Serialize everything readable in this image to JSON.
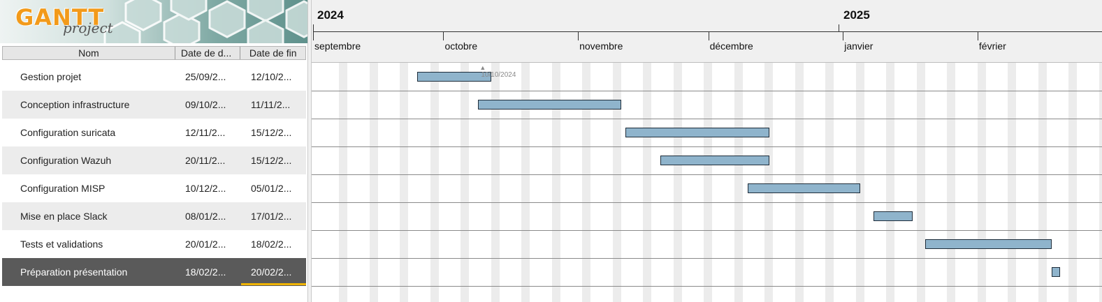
{
  "logo": {
    "main": "GANTT",
    "sub": "project"
  },
  "columns": {
    "name": "Nom",
    "start": "Date de d...",
    "end": "Date de fin"
  },
  "tasks": [
    {
      "name": "Gestion projet",
      "start": "25/09/2...",
      "end": "12/10/2...",
      "start_date": "2024-09-25",
      "end_date": "2024-10-12"
    },
    {
      "name": "Conception infrastructure",
      "start": "09/10/2...",
      "end": "11/11/2...",
      "start_date": "2024-10-09",
      "end_date": "2024-11-11"
    },
    {
      "name": "Configuration suricata",
      "start": "12/11/2...",
      "end": "15/12/2...",
      "start_date": "2024-11-12",
      "end_date": "2024-12-15"
    },
    {
      "name": "Configuration Wazuh",
      "start": "20/11/2...",
      "end": "15/12/2...",
      "start_date": "2024-11-20",
      "end_date": "2024-12-15"
    },
    {
      "name": "Configuration MISP",
      "start": "10/12/2...",
      "end": "05/01/2...",
      "start_date": "2024-12-10",
      "end_date": "2025-01-05"
    },
    {
      "name": "Mise en place Slack",
      "start": "08/01/2...",
      "end": "17/01/2...",
      "start_date": "2025-01-08",
      "end_date": "2025-01-17"
    },
    {
      "name": "Tests et validations",
      "start": "20/01/2...",
      "end": "18/02/2...",
      "start_date": "2025-01-20",
      "end_date": "2025-02-18"
    },
    {
      "name": "Préparation présentation",
      "start": "18/02/2...",
      "end": "20/02/2...",
      "start_date": "2025-02-18",
      "end_date": "2025-02-20"
    }
  ],
  "selected_index": 7,
  "timeline": {
    "years": [
      "2024",
      "2025"
    ],
    "months": [
      "septembre",
      "octobre",
      "novembre",
      "décembre",
      "janvier",
      "février"
    ],
    "today_label": "10/10/2024",
    "today_date": "2024-10-10"
  },
  "colors": {
    "bar": "#8fb4cc",
    "bar_border": "#1f2d3a",
    "selection": "#5a5a5a",
    "selection_accent": "#f0b400"
  }
}
